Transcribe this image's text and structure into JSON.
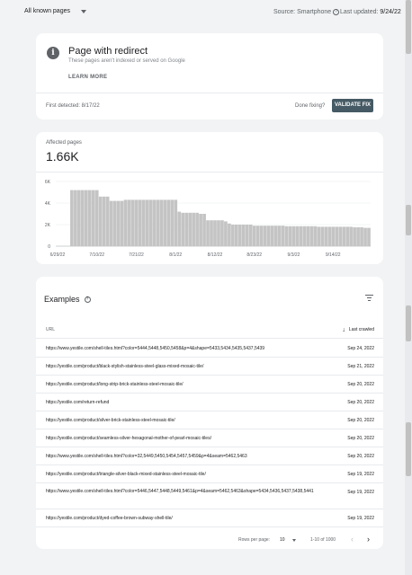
{
  "topbar": {
    "filter_label": "All known pages",
    "source_label": "Source: Smartphone",
    "updated_label": "Last updated:",
    "updated_value": "9/24/22"
  },
  "status_card": {
    "title": "Page with redirect",
    "subtitle": "These pages aren't indexed or served on Google",
    "learn_more": "LEARN MORE",
    "first_detected": "First detected: 8/17/22",
    "done_fixing": "Done fixing?",
    "validate_label": "VALIDATE FIX"
  },
  "affected_card": {
    "label": "Affected pages",
    "value": "1.66K"
  },
  "chart_data": {
    "type": "bar",
    "categories": [
      "6/29/22",
      "6/30/22",
      "7/1/22",
      "7/2/22",
      "7/3/22",
      "7/4/22",
      "7/5/22",
      "7/6/22",
      "7/7/22",
      "7/8/22",
      "7/9/22",
      "7/10/22",
      "7/11/22",
      "7/12/22",
      "7/13/22",
      "7/14/22",
      "7/15/22",
      "7/16/22",
      "7/17/22",
      "7/18/22",
      "7/19/22",
      "7/20/22",
      "7/21/22",
      "7/22/22",
      "7/23/22",
      "7/24/22",
      "7/25/22",
      "7/26/22",
      "7/27/22",
      "7/28/22",
      "7/29/22",
      "7/30/22",
      "7/31/22",
      "8/1/22",
      "8/2/22",
      "8/3/22",
      "8/4/22",
      "8/5/22",
      "8/6/22",
      "8/7/22",
      "8/8/22",
      "8/9/22",
      "8/10/22",
      "8/11/22",
      "8/12/22",
      "8/13/22",
      "8/14/22",
      "8/15/22",
      "8/16/22",
      "8/17/22",
      "8/18/22",
      "8/19/22",
      "8/20/22",
      "8/21/22",
      "8/22/22",
      "8/23/22",
      "8/24/22",
      "8/25/22",
      "8/26/22",
      "8/27/22",
      "8/28/22",
      "8/29/22",
      "8/30/22",
      "8/31/22",
      "9/1/22",
      "9/2/22",
      "9/3/22",
      "9/4/22",
      "9/5/22",
      "9/6/22",
      "9/7/22",
      "9/8/22",
      "9/9/22",
      "9/10/22",
      "9/11/22",
      "9/12/22",
      "9/13/22",
      "9/14/22",
      "9/15/22",
      "9/16/22",
      "9/17/22",
      "9/18/22",
      "9/19/22",
      "9/20/22",
      "9/21/22",
      "9/22/22",
      "9/23/22",
      "9/24/22"
    ],
    "values": [
      0,
      0,
      0,
      0,
      5200,
      5200,
      5200,
      5200,
      5200,
      5200,
      5200,
      5200,
      4600,
      4600,
      4600,
      4200,
      4200,
      4200,
      4200,
      4300,
      4300,
      4300,
      4300,
      4300,
      4300,
      4300,
      4300,
      4300,
      4300,
      4300,
      4300,
      4300,
      4300,
      4300,
      3200,
      3100,
      3100,
      3100,
      3100,
      3100,
      3000,
      3000,
      2400,
      2400,
      2400,
      2400,
      2400,
      2300,
      2100,
      2000,
      2000,
      2000,
      2000,
      2000,
      2000,
      1900,
      1900,
      1900,
      1900,
      1900,
      1900,
      1900,
      1900,
      1900,
      1850,
      1850,
      1850,
      1850,
      1850,
      1850,
      1850,
      1850,
      1850,
      1800,
      1800,
      1800,
      1800,
      1800,
      1800,
      1800,
      1800,
      1800,
      1800,
      1750,
      1750,
      1750,
      1700,
      1700
    ],
    "y_ticks": [
      "0",
      "2K",
      "4K",
      "6K"
    ],
    "x_ticks": [
      "6/29/22",
      "7/10/22",
      "7/21/22",
      "8/1/22",
      "8/12/22",
      "8/23/22",
      "9/3/22",
      "9/14/22"
    ],
    "ylim": [
      0,
      6000
    ],
    "bar_color": "#c4c4c4",
    "grid": true
  },
  "examples": {
    "title": "Examples",
    "col_url": "URL",
    "col_crawled": "Last crawled",
    "rows": [
      {
        "url": "https://www.yestile.com/shell-tiles.html?color=5444,5448,5450,5458&p=4&shape=5433,5434,5435,5437,5439",
        "date": "Sep 24, 2022"
      },
      {
        "url": "https://yestile.com/product/black-stylish-stainless-steel-glass-mixed-mosaic-tile/",
        "date": "Sep 21, 2022"
      },
      {
        "url": "https://yestile.com/product/long-strip-brick-stainless-steel-mosaic-tile/",
        "date": "Sep 20, 2022"
      },
      {
        "url": "https://yestile.com/return-refund",
        "date": "Sep 20, 2022"
      },
      {
        "url": "https://yestile.com/product/silver-brick-stainless-steel-mosaic-tile/",
        "date": "Sep 20, 2022"
      },
      {
        "url": "https://yestile.com/product/seamless-silver-hexagonal-mother-of-pearl-mosaic-tiles/",
        "date": "Sep 20, 2022"
      },
      {
        "url": "https://www.yestile.com/shell-tiles.html?color=32,5449,5450,5454,5457,5459&p=4&seam=5462,5463",
        "date": "Sep 20, 2022"
      },
      {
        "url": "https://yestile.com/product/triangle-silver-black-mixed-stainless-steel-mosaic-tile/",
        "date": "Sep 19, 2022"
      },
      {
        "url": "https://www.yestile.com/shell-tiles.html?color=5446,5447,5448,5449,5461&p=4&seam=5462,5463&shape=5434,5436,5437,5438,5441",
        "date": "Sep 19, 2022"
      },
      {
        "url": "https://yestile.com/product/dyed-coffee-brown-subway-shell-tile/",
        "date": "Sep 19, 2022"
      }
    ],
    "rows_per_page_label": "Rows per page:",
    "rows_per_page": "10",
    "range": "1-10 of 1000"
  }
}
